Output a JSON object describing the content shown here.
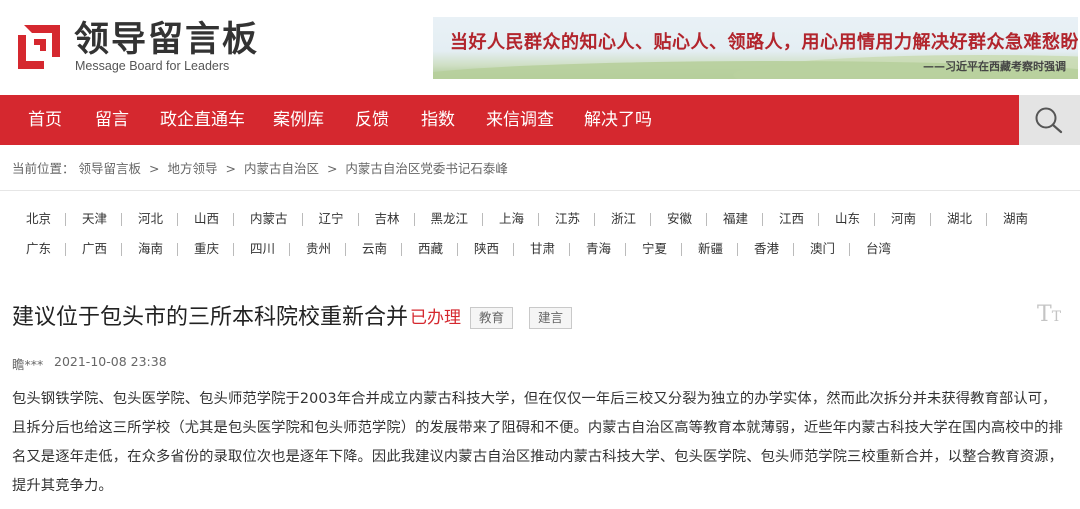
{
  "header": {
    "logo_title": "领导留言板",
    "logo_subtitle": "Message Board for Leaders",
    "banner_quote": "当好人民群众的知心人、贴心人、领路人，用心用情用力解决好群众急难愁盼问题。",
    "banner_author": "——习近平在西藏考察时强调"
  },
  "nav": {
    "items": [
      "首页",
      "留言",
      "政企直通车",
      "案例库",
      "反馈",
      "指数",
      "来信调查",
      "解决了吗"
    ]
  },
  "breadcrumb": {
    "prefix": "当前位置：",
    "items": [
      "领导留言板",
      ">",
      "地方领导",
      ">",
      "内蒙古自治区",
      ">",
      "内蒙古自治区党委书记石泰峰"
    ]
  },
  "regions": {
    "row1": [
      "北京",
      "天津",
      "河北",
      "山西",
      "内蒙古",
      "辽宁",
      "吉林",
      "黑龙江",
      "上海",
      "江苏",
      "浙江",
      "安徽",
      "福建",
      "江西",
      "山东",
      "河南",
      "湖北",
      "湖南"
    ],
    "row2": [
      "广东",
      "广西",
      "海南",
      "重庆",
      "四川",
      "贵州",
      "云南",
      "西藏",
      "陕西",
      "甘肃",
      "青海",
      "宁夏",
      "新疆",
      "香港",
      "澳门",
      "台湾"
    ]
  },
  "post": {
    "title": "建议位于包头市的三所本科院校重新合并",
    "status": "已办理",
    "tags": [
      "教育",
      "建言"
    ],
    "font_toggle": "T",
    "author": "瞻***",
    "time": "2021-10-08 23:38",
    "body": "包头钢铁学院、包头医学院、包头师范学院于2003年合并成立内蒙古科技大学，但在仅仅一年后三校又分裂为独立的办学实体，然而此次拆分并未获得教育部认可，且拆分后也给这三所学校（尤其是包头医学院和包头师范学院）的发展带来了阻碍和不便。内蒙古自治区高等教育本就薄弱，近些年内蒙古科技大学在国内高校中的排名又是逐年走低，在众多省份的录取位次也是逐年下降。因此我建议内蒙古自治区推动内蒙古科技大学、包头医学院、包头师范学院三校重新合并，以整合教育资源，提升其竞争力。"
  },
  "colors": {
    "brand_red": "#d5282f",
    "search_bg": "#e4e4e4"
  },
  "icons": {
    "logo": "logo-mark-icon",
    "search": "search-icon",
    "font_size": "font-size-icon"
  }
}
